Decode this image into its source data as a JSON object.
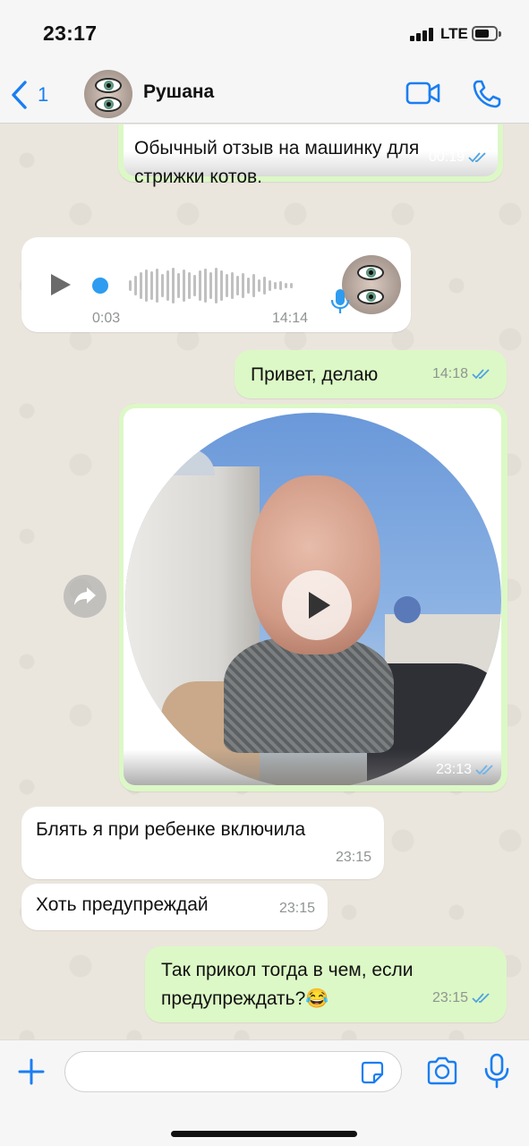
{
  "status_bar": {
    "time": "23:17",
    "network": "LTE"
  },
  "header": {
    "back_count": "1",
    "contact_name": "Рушана",
    "icons": {
      "back": "chevron-left-icon",
      "video": "video-call-icon",
      "phone": "phone-call-icon"
    },
    "accent_color": "#1a7ef2"
  },
  "messages": [
    {
      "direction": "outgoing",
      "type": "text",
      "text": "Обычный отзыв на машинку для стрижки котов.",
      "time": "00:19",
      "read": true
    },
    {
      "direction": "incoming",
      "type": "voice",
      "duration": "0:03",
      "time": "14:14"
    },
    {
      "direction": "outgoing",
      "type": "text",
      "text": "Привет, делаю",
      "time": "14:18",
      "read": true
    },
    {
      "direction": "outgoing",
      "type": "video_note",
      "time": "23:13",
      "read": true
    },
    {
      "direction": "incoming",
      "type": "text",
      "text": "Блять я при ребенке включила",
      "time": "23:15"
    },
    {
      "direction": "incoming",
      "type": "text",
      "text": "Хоть предупреждай",
      "time": "23:15"
    },
    {
      "direction": "outgoing",
      "type": "text",
      "text": "Так прикол тогда в чем, если предупреждать?😂",
      "time": "23:15",
      "read": true
    }
  ],
  "input_bar": {
    "placeholder": "",
    "icons": {
      "attach": "plus-icon",
      "sticker": "sticker-icon",
      "camera": "camera-icon",
      "mic": "microphone-icon"
    }
  },
  "colors": {
    "outgoing_bubble": "#dcf8c6",
    "incoming_bubble": "#ffffff",
    "read_ticks": "#4fa3e0",
    "chat_background": "#ebe6dd"
  }
}
